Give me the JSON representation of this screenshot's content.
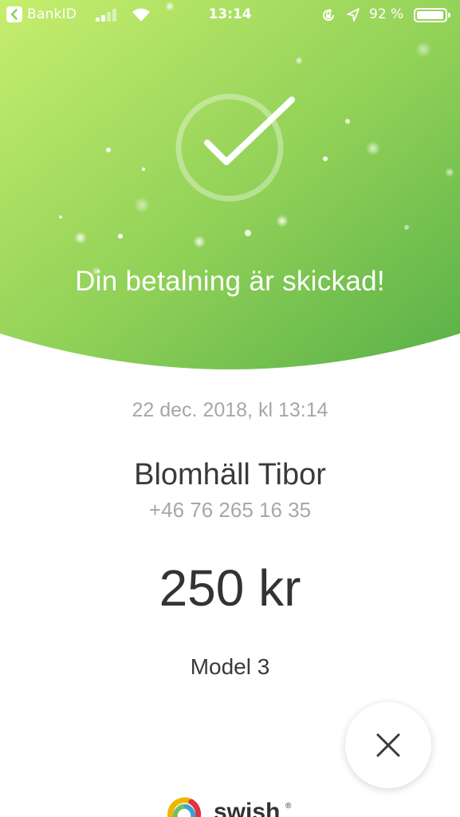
{
  "status_bar": {
    "back_app": "BankID",
    "time": "13:14",
    "battery": "92 %"
  },
  "colors": {
    "green_light": "#c2ec6c",
    "green_dark": "#5cb449",
    "text_dark": "#3a3a3a",
    "text_grey": "#a7a7a7"
  },
  "hero": {
    "title": "Din betalning är skickad!",
    "icon": "check-circle-icon"
  },
  "payment": {
    "date": "22 dec. 2018, kl 13:14",
    "recipient_name": "Blomhäll Tibor",
    "recipient_phone": "+46 76 265 16 35",
    "amount": "250 kr",
    "message": "Model 3"
  },
  "close": {
    "icon": "close-icon"
  },
  "brand": {
    "name": "swish",
    "mark": "®"
  }
}
